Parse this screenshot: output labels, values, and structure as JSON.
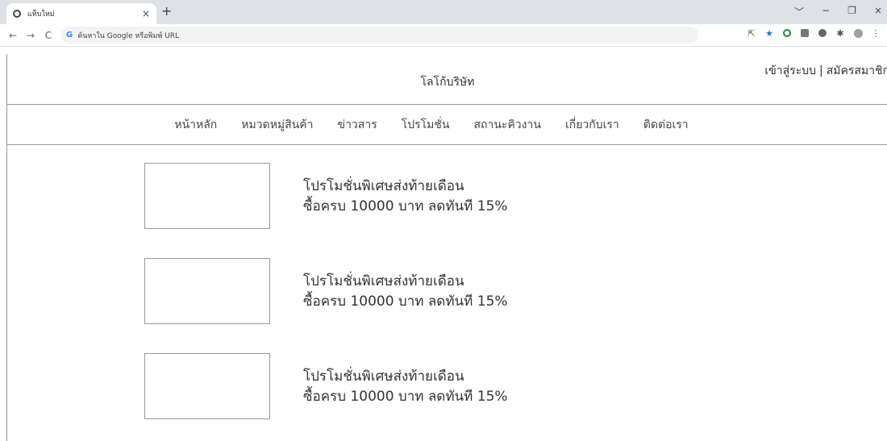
{
  "browser": {
    "tab_title": "แท็บใหม่",
    "tab_close": "×",
    "new_tab": "+",
    "omnibox_placeholder": "ค้นหาใน Google หรือพิมพ์ URL",
    "window_controls": [
      "﹀",
      "−",
      "❐",
      "×"
    ]
  },
  "header": {
    "logo": "โลโก้บริษัท",
    "login": "เข้าสู่ระบบ",
    "separator": "|",
    "register": "สมัครสมาชิก"
  },
  "nav": {
    "items": [
      "หน้าหลัก",
      "หมวดหมู่สินค้า",
      "ข่าวสาร",
      "โปรโมชั่น",
      "สถานะคิวงาน",
      "เกี่ยวกับเรา",
      "ติดต่อเรา"
    ]
  },
  "promos": [
    {
      "title": "โปรโมชั่นพิเศษส่งท้ายเดือน",
      "detail": "ซื้อครบ 10000 บาท ลดทันที 15%"
    },
    {
      "title": "โปรโมชั่นพิเศษส่งท้ายเดือน",
      "detail": "ซื้อครบ 10000 บาท ลดทันที 15%"
    },
    {
      "title": "โปรโมชั่นพิเศษส่งท้ายเดือน",
      "detail": "ซื้อครบ 10000 บาท ลดทันที 15%"
    }
  ],
  "colors": {
    "border": "#999999",
    "text": "#333333",
    "accent": "#1a73e8"
  }
}
